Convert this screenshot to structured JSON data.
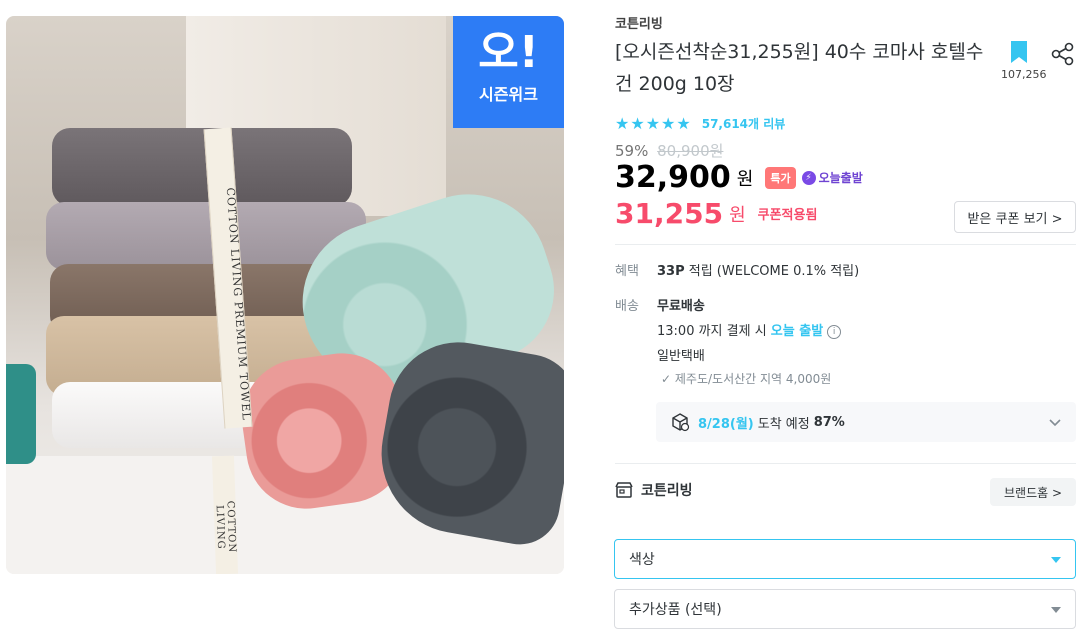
{
  "image": {
    "badge_big": "오!",
    "badge_small": "시즌위크",
    "ribbon_text": "COTTON LIVING PREMIUM TOWEL",
    "ribbon_text_2": "COTTON LIVING"
  },
  "product": {
    "brand": "코튼리빙",
    "title": "[오시즌선착순31,255원] 40수 코마사 호텔수건 200g 10장",
    "bookmark_count": "107,256",
    "rating_stars": "★★★★★",
    "review_count": "57,614개 리뷰",
    "discount_rate": "59%",
    "original_price": "80,900원",
    "price": "32,900",
    "price_unit": "원",
    "special_badge": "특가",
    "today_ship_badge": "오늘출발",
    "coupon_price": "31,255",
    "coupon_unit": "원",
    "coupon_label": "쿠폰적용됨",
    "coupon_button": "받은 쿠폰 보기 >"
  },
  "benefit": {
    "label": "혜택",
    "points": "33P",
    "text": " 적립 (WELCOME 0.1% 적립)"
  },
  "shipping": {
    "label": "배송",
    "type": "무료배송",
    "deadline_prefix": "13:00 까지 결제 시 ",
    "deadline_highlight": "오늘 출발",
    "method": "일반택배",
    "exception": "✓ 제주도/도서산간 지역 4,000원",
    "eta_date": "8/28(월)",
    "eta_text": "도착 예정",
    "eta_pct": "87%"
  },
  "store": {
    "name": "코튼리빙",
    "brand_home": "브랜드홈 >"
  },
  "options": {
    "color": "색상",
    "extra": "추가상품 (선택)"
  },
  "colors": {
    "accent": "#35c5f0",
    "sale": "#f74b6b",
    "badge_blue": "#2d7cf5"
  }
}
